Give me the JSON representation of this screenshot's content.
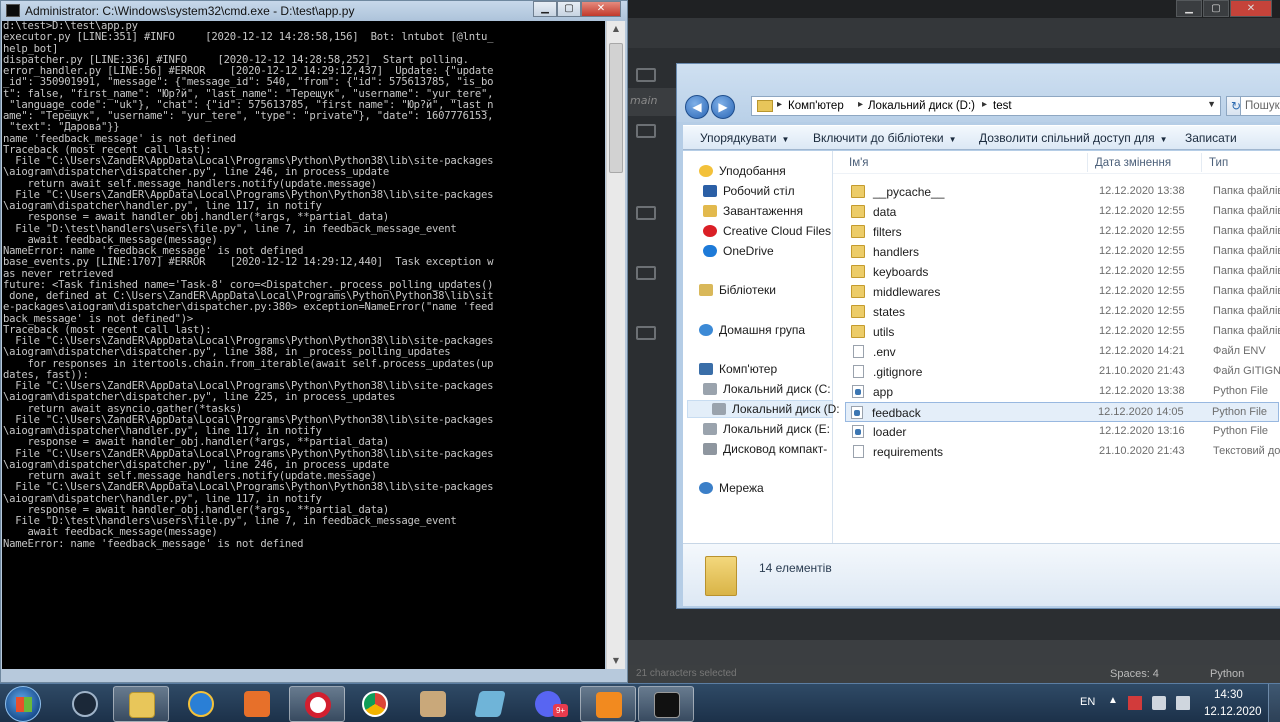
{
  "background_editor": {
    "sidebar_tab": "main",
    "status_left": "21 characters selected",
    "status_spaces": "Spaces: 4",
    "status_language": "Python"
  },
  "cmd": {
    "title": "Administrator: C:\\Windows\\system32\\cmd.exe - D:\\test\\app.py",
    "minimize": "▁",
    "maximize": "▢",
    "close": "✕",
    "output": "d:\\test>D:\\test\\app.py\nexecutor.py [LINE:351] #INFO     [2020-12-12 14:28:58,156]  Bot: lntubot [@lntu_\nhelp_bot]\ndispatcher.py [LINE:336] #INFO     [2020-12-12 14:28:58,252]  Start polling.\nerror_handler.py [LINE:56] #ERROR    [2020-12-12 14:29:12,437]  Update: {\"update\n_id\": 350901991, \"message\": {\"message_id\": 540, \"from\": {\"id\": 575613785, \"is_bo\nt\": false, \"first_name\": \"Юр?й\", \"last_name\": \"Терещук\", \"username\": \"yur_tere\",\n \"language_code\": \"uk\"}, \"chat\": {\"id\": 575613785, \"first_name\": \"Юр?й\", \"last_n\name\": \"Терещук\", \"username\": \"yur_tere\", \"type\": \"private\"}, \"date\": 1607776153,\n \"text\": \"Дарова\"}}\nname 'feedback_message' is not defined\nTraceback (most recent call last):\n  File \"C:\\Users\\ZandER\\AppData\\Local\\Programs\\Python\\Python38\\lib\\site-packages\n\\aiogram\\dispatcher\\dispatcher.py\", line 246, in process_update\n    return await self.message_handlers.notify(update.message)\n  File \"C:\\Users\\ZandER\\AppData\\Local\\Programs\\Python\\Python38\\lib\\site-packages\n\\aiogram\\dispatcher\\handler.py\", line 117, in notify\n    response = await handler_obj.handler(*args, **partial_data)\n  File \"D:\\test\\handlers\\users\\file.py\", line 7, in feedback_message_event\n    await feedback_message(message)\nNameError: name 'feedback_message' is not defined\nbase_events.py [LINE:1707] #ERROR    [2020-12-12 14:29:12,440]  Task exception w\nas never retrieved\nfuture: <Task finished name='Task-8' coro=<Dispatcher._process_polling_updates()\n done, defined at C:\\Users\\ZandER\\AppData\\Local\\Programs\\Python\\Python38\\lib\\sit\ne-packages\\aiogram\\dispatcher\\dispatcher.py:380> exception=NameError(\"name 'feed\nback_message' is not defined\")>\nTraceback (most recent call last):\n  File \"C:\\Users\\ZandER\\AppData\\Local\\Programs\\Python\\Python38\\lib\\site-packages\n\\aiogram\\dispatcher\\dispatcher.py\", line 388, in _process_polling_updates\n    for responses in itertools.chain.from_iterable(await self.process_updates(up\ndates, fast)):\n  File \"C:\\Users\\ZandER\\AppData\\Local\\Programs\\Python\\Python38\\lib\\site-packages\n\\aiogram\\dispatcher\\dispatcher.py\", line 225, in process_updates\n    return await asyncio.gather(*tasks)\n  File \"C:\\Users\\ZandER\\AppData\\Local\\Programs\\Python\\Python38\\lib\\site-packages\n\\aiogram\\dispatcher\\handler.py\", line 117, in notify\n    response = await handler_obj.handler(*args, **partial_data)\n  File \"C:\\Users\\ZandER\\AppData\\Local\\Programs\\Python\\Python38\\lib\\site-packages\n\\aiogram\\dispatcher\\dispatcher.py\", line 246, in process_update\n    return await self.message_handlers.notify(update.message)\n  File \"C:\\Users\\ZandER\\AppData\\Local\\Programs\\Python\\Python38\\lib\\site-packages\n\\aiogram\\dispatcher\\handler.py\", line 117, in notify\n    response = await handler_obj.handler(*args, **partial_data)\n  File \"D:\\test\\handlers\\users\\file.py\", line 7, in feedback_message_event\n    await feedback_message(message)\nNameError: name 'feedback_message' is not defined"
  },
  "explorer": {
    "address": [
      "Комп'ютер",
      "Локальний диск (D:)",
      "test"
    ],
    "search_placeholder": "Пошук",
    "toolbar": [
      "Упорядкувати",
      "Включити до бібліотеки",
      "Дозволити спільний доступ для",
      "Записати"
    ],
    "columns": {
      "name": "Ім'я",
      "date": "Дата змінення",
      "type": "Тип"
    },
    "sidebar": [
      {
        "label": "Уподобання",
        "icon": "star-icon"
      },
      {
        "label": "Робочий стіл",
        "icon": "desktop-icon"
      },
      {
        "label": "Завантаження",
        "icon": "downloads-icon"
      },
      {
        "label": "Creative Cloud Files",
        "icon": "creative-cloud-icon"
      },
      {
        "label": "OneDrive",
        "icon": "onedrive-icon"
      },
      {
        "label": "Бібліотеки",
        "icon": "libraries-icon"
      },
      {
        "label": "Домашня група",
        "icon": "homegroup-icon"
      },
      {
        "label": "Комп'ютер",
        "icon": "computer-icon"
      },
      {
        "label": "Локальний диск (C:",
        "icon": "drive-icon"
      },
      {
        "label": "Локальний диск (D:",
        "icon": "drive-icon"
      },
      {
        "label": "Локальний диск (E:",
        "icon": "drive-icon"
      },
      {
        "label": "Дисковод компакт-",
        "icon": "cd-drive-icon"
      },
      {
        "label": "Мережа",
        "icon": "network-icon"
      }
    ],
    "files": [
      {
        "name": "__pycache__",
        "date": "12.12.2020 13:38",
        "type": "Папка файлів",
        "kind": "folder"
      },
      {
        "name": "data",
        "date": "12.12.2020 12:55",
        "type": "Папка файлів",
        "kind": "folder"
      },
      {
        "name": "filters",
        "date": "12.12.2020 12:55",
        "type": "Папка файлів",
        "kind": "folder"
      },
      {
        "name": "handlers",
        "date": "12.12.2020 12:55",
        "type": "Папка файлів",
        "kind": "folder"
      },
      {
        "name": "keyboards",
        "date": "12.12.2020 12:55",
        "type": "Папка файлів",
        "kind": "folder"
      },
      {
        "name": "middlewares",
        "date": "12.12.2020 12:55",
        "type": "Папка файлів",
        "kind": "folder"
      },
      {
        "name": "states",
        "date": "12.12.2020 12:55",
        "type": "Папка файлів",
        "kind": "folder"
      },
      {
        "name": "utils",
        "date": "12.12.2020 12:55",
        "type": "Папка файлів",
        "kind": "folder"
      },
      {
        "name": ".env",
        "date": "12.12.2020 14:21",
        "type": "Файл ENV",
        "kind": "txt"
      },
      {
        "name": ".gitignore",
        "date": "21.10.2020 21:43",
        "type": "Файл GITIGNORE",
        "kind": "txt"
      },
      {
        "name": "app",
        "date": "12.12.2020 13:38",
        "type": "Python File",
        "kind": "py"
      },
      {
        "name": "feedback",
        "date": "12.12.2020 14:05",
        "type": "Python File",
        "kind": "py",
        "selected": true
      },
      {
        "name": "loader",
        "date": "12.12.2020 13:16",
        "type": "Python File",
        "kind": "py"
      },
      {
        "name": "requirements",
        "date": "21.10.2020 21:43",
        "type": "Текстовий документ",
        "kind": "txt"
      }
    ],
    "item_count": "14 елементів"
  },
  "taskbar": {
    "apps": [
      {
        "name": "steam",
        "color": "#1b2838"
      },
      {
        "name": "file-explorer",
        "color": "#e8c65a",
        "active": true
      },
      {
        "name": "internet-explorer",
        "color": "#2a7fd6"
      },
      {
        "name": "media-player",
        "color": "#e7702a"
      },
      {
        "name": "opera",
        "color": "#d21f2f"
      },
      {
        "name": "chrome",
        "color": "#3ba55c"
      },
      {
        "name": "genshin-character",
        "color": "#c9a87a"
      },
      {
        "name": "notes-app",
        "color": "#6fb4d8"
      },
      {
        "name": "discord",
        "color": "#5865f2",
        "badge": "9+"
      },
      {
        "name": "sublime-text",
        "color": "#f28a1f"
      },
      {
        "name": "cmd",
        "color": "#111111",
        "active": true
      }
    ],
    "tray": {
      "language": "EN",
      "time": "14:30",
      "date": "12.12.2020"
    }
  }
}
